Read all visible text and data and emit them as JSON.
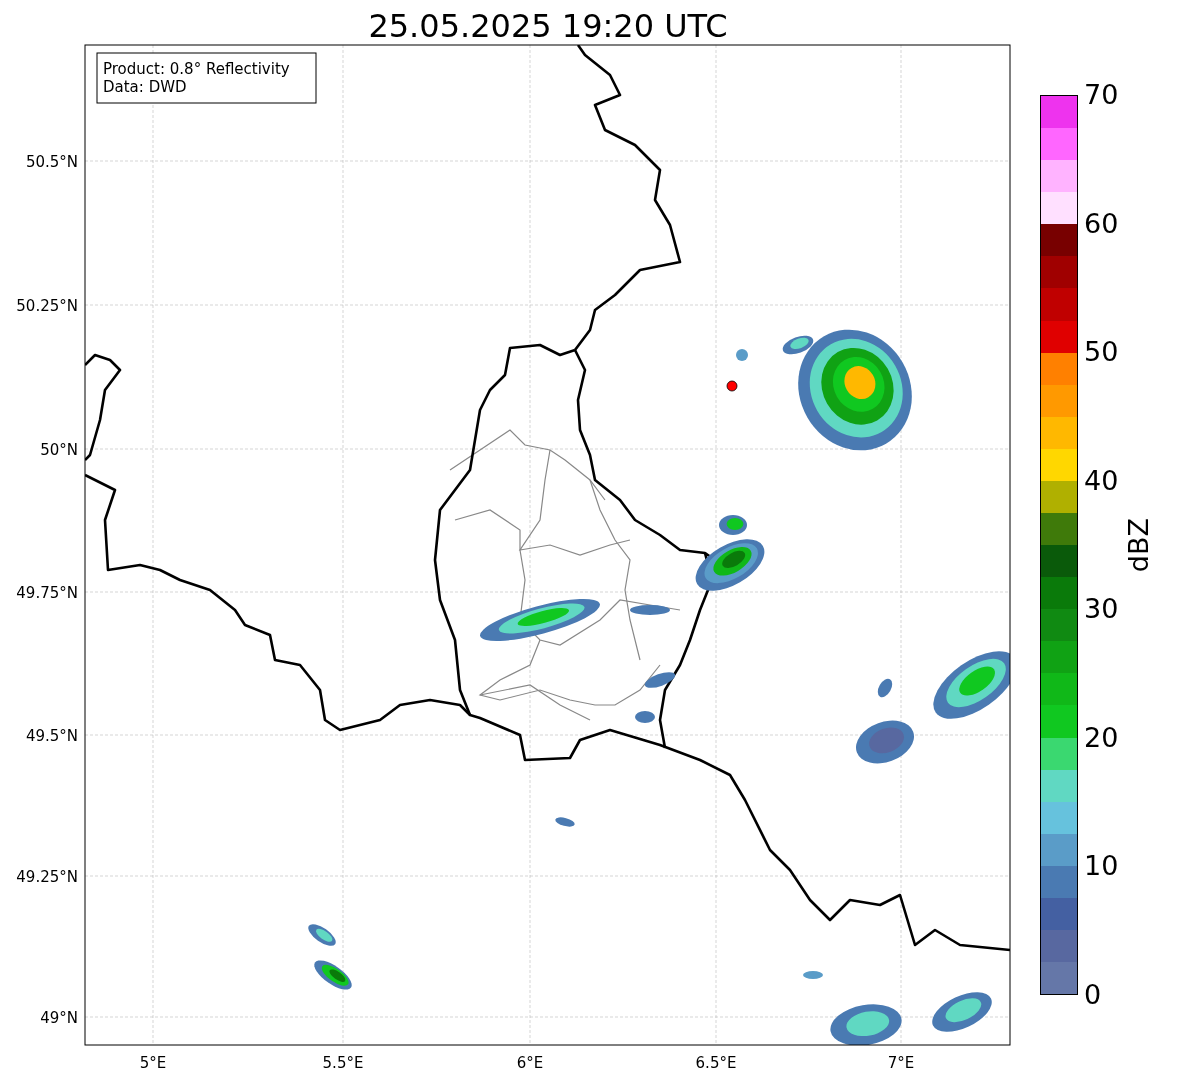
{
  "title": "25.05.2025 19:20 UTC",
  "map": {
    "info_lines": [
      "Product: 0.8° Reflectivity",
      "Data: DWD"
    ],
    "lat_labels": [
      "50.5°N",
      "50.25°N",
      "50°N",
      "49.75°N",
      "49.5°N",
      "49.25°N",
      "49°N"
    ],
    "lon_labels": [
      "5°E",
      "5.5°E",
      "6°E",
      "6.5°E",
      "7°E"
    ]
  },
  "colorbar": {
    "label": "dBZ",
    "ticks": [
      "70",
      "60",
      "50",
      "40",
      "30",
      "20",
      "10",
      "0"
    ],
    "bands": [
      {
        "color": "#ee33ee"
      },
      {
        "color": "#ff66ff"
      },
      {
        "color": "#ffb3ff"
      },
      {
        "color": "#ffe0ff"
      },
      {
        "color": "#780000"
      },
      {
        "color": "#a00000"
      },
      {
        "color": "#c00000"
      },
      {
        "color": "#e00000"
      },
      {
        "color": "#ff8000"
      },
      {
        "color": "#ff9900"
      },
      {
        "color": "#ffb800"
      },
      {
        "color": "#ffd700"
      },
      {
        "color": "#b0b000"
      },
      {
        "color": "#3f7a0a"
      },
      {
        "color": "#0a5a0a"
      },
      {
        "color": "#0a7a0a"
      },
      {
        "color": "#108a12"
      },
      {
        "color": "#10a214"
      },
      {
        "color": "#10b818"
      },
      {
        "color": "#10c820"
      },
      {
        "color": "#3ad870"
      },
      {
        "color": "#60d8c2"
      },
      {
        "color": "#66c2dd"
      },
      {
        "color": "#5a9cc8"
      },
      {
        "color": "#4a7ab2"
      },
      {
        "color": "#4460a2"
      },
      {
        "color": "#5868a0"
      },
      {
        "color": "#6577a8"
      }
    ]
  }
}
